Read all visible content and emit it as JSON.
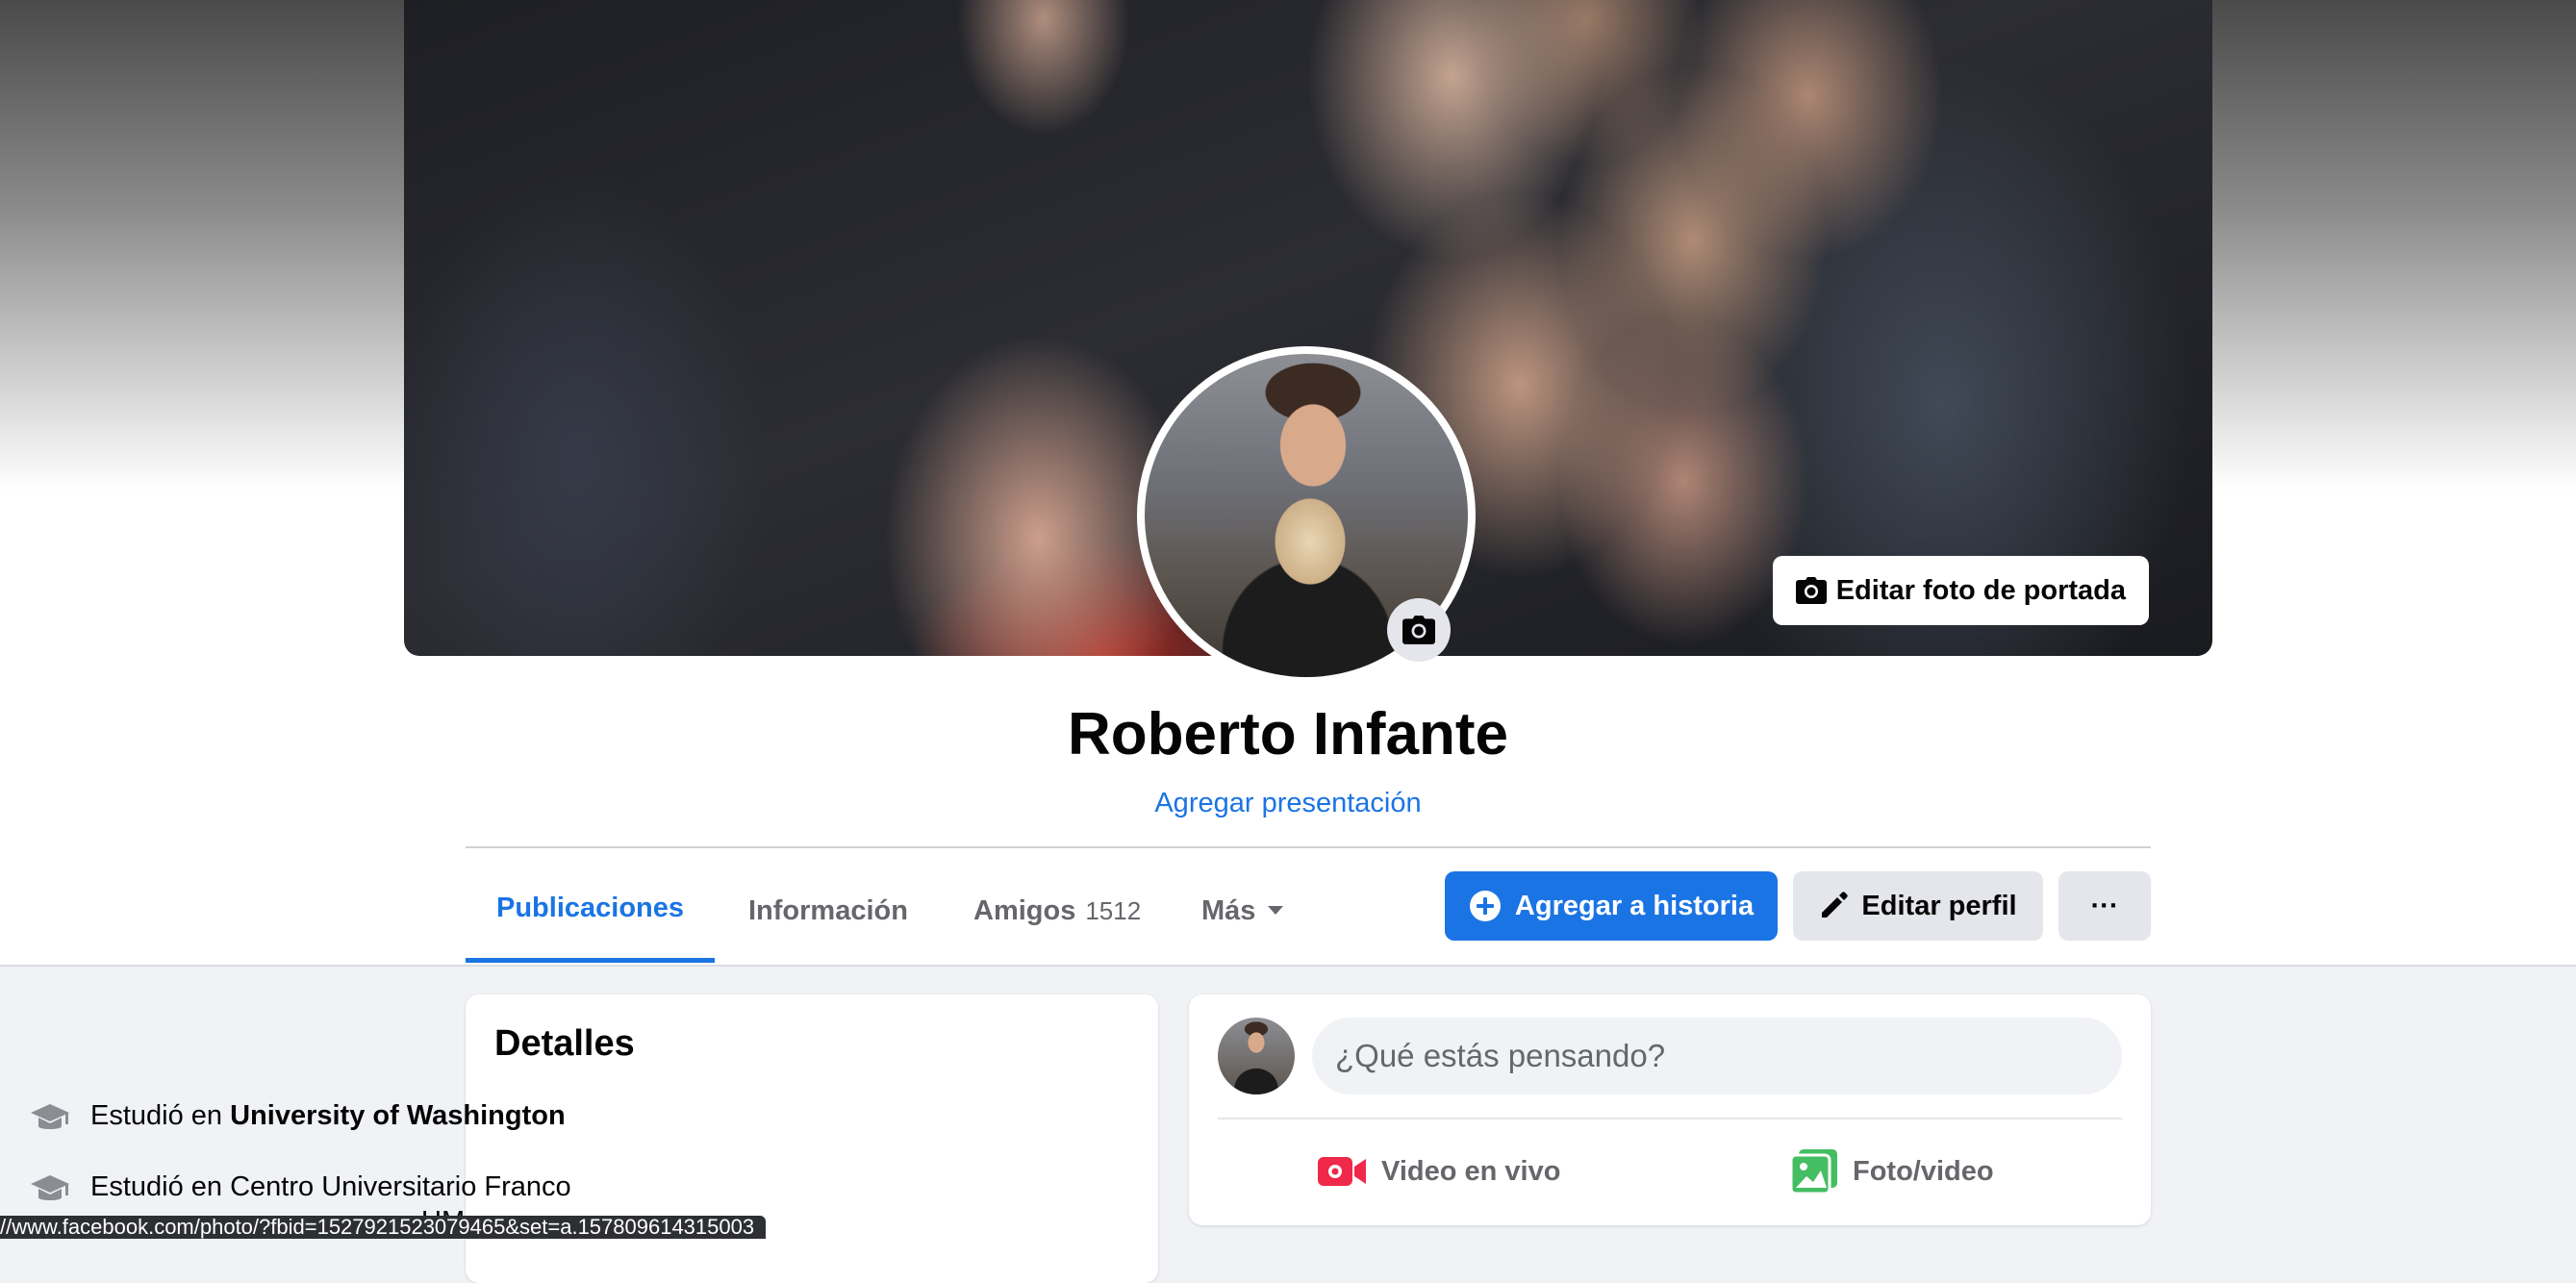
{
  "cover": {
    "edit_button_label": "Editar foto de portada",
    "edit_button_icon": "camera-icon"
  },
  "profile": {
    "name": "Roberto Infante",
    "add_bio_label": "Agregar presentación",
    "avatar_camera_icon": "camera-icon"
  },
  "tabs": [
    {
      "label": "Publicaciones",
      "active": true
    },
    {
      "label": "Información"
    },
    {
      "label": "Amigos",
      "count": "1512"
    },
    {
      "label": "Más",
      "icon": "caret-down-icon"
    }
  ],
  "actions": {
    "add_story_label": "Agregar a historia",
    "add_story_icon": "plus-circle-icon",
    "edit_profile_label": "Editar perfil",
    "edit_profile_icon": "pencil-icon",
    "more_label": "···"
  },
  "details": {
    "title": "Detalles",
    "items": [
      {
        "prefix": "Estudió en ",
        "bold": "University of Washington",
        "icon": "graduation-cap-icon"
      },
      {
        "prefix": "Estudió en ",
        "bold": "",
        "text": "Centro Universitario Franco",
        "trailing": "UM",
        "icon": "graduation-cap-icon"
      }
    ]
  },
  "composer": {
    "placeholder": "¿Qué estás pensando?",
    "live_video_label": "Video en vivo",
    "live_video_icon": "video-camera-icon",
    "photo_video_label": "Foto/video",
    "photo_video_icon": "photo-icon"
  },
  "status_bar": {
    "url": "//www.facebook.com/photo/?fbid=1527921523079465&set=a.157809614315003"
  },
  "colors": {
    "accent": "#1b74e4",
    "live_red": "#f02849",
    "photo_green": "#45bd62",
    "page_bg": "#f0f2f5"
  }
}
